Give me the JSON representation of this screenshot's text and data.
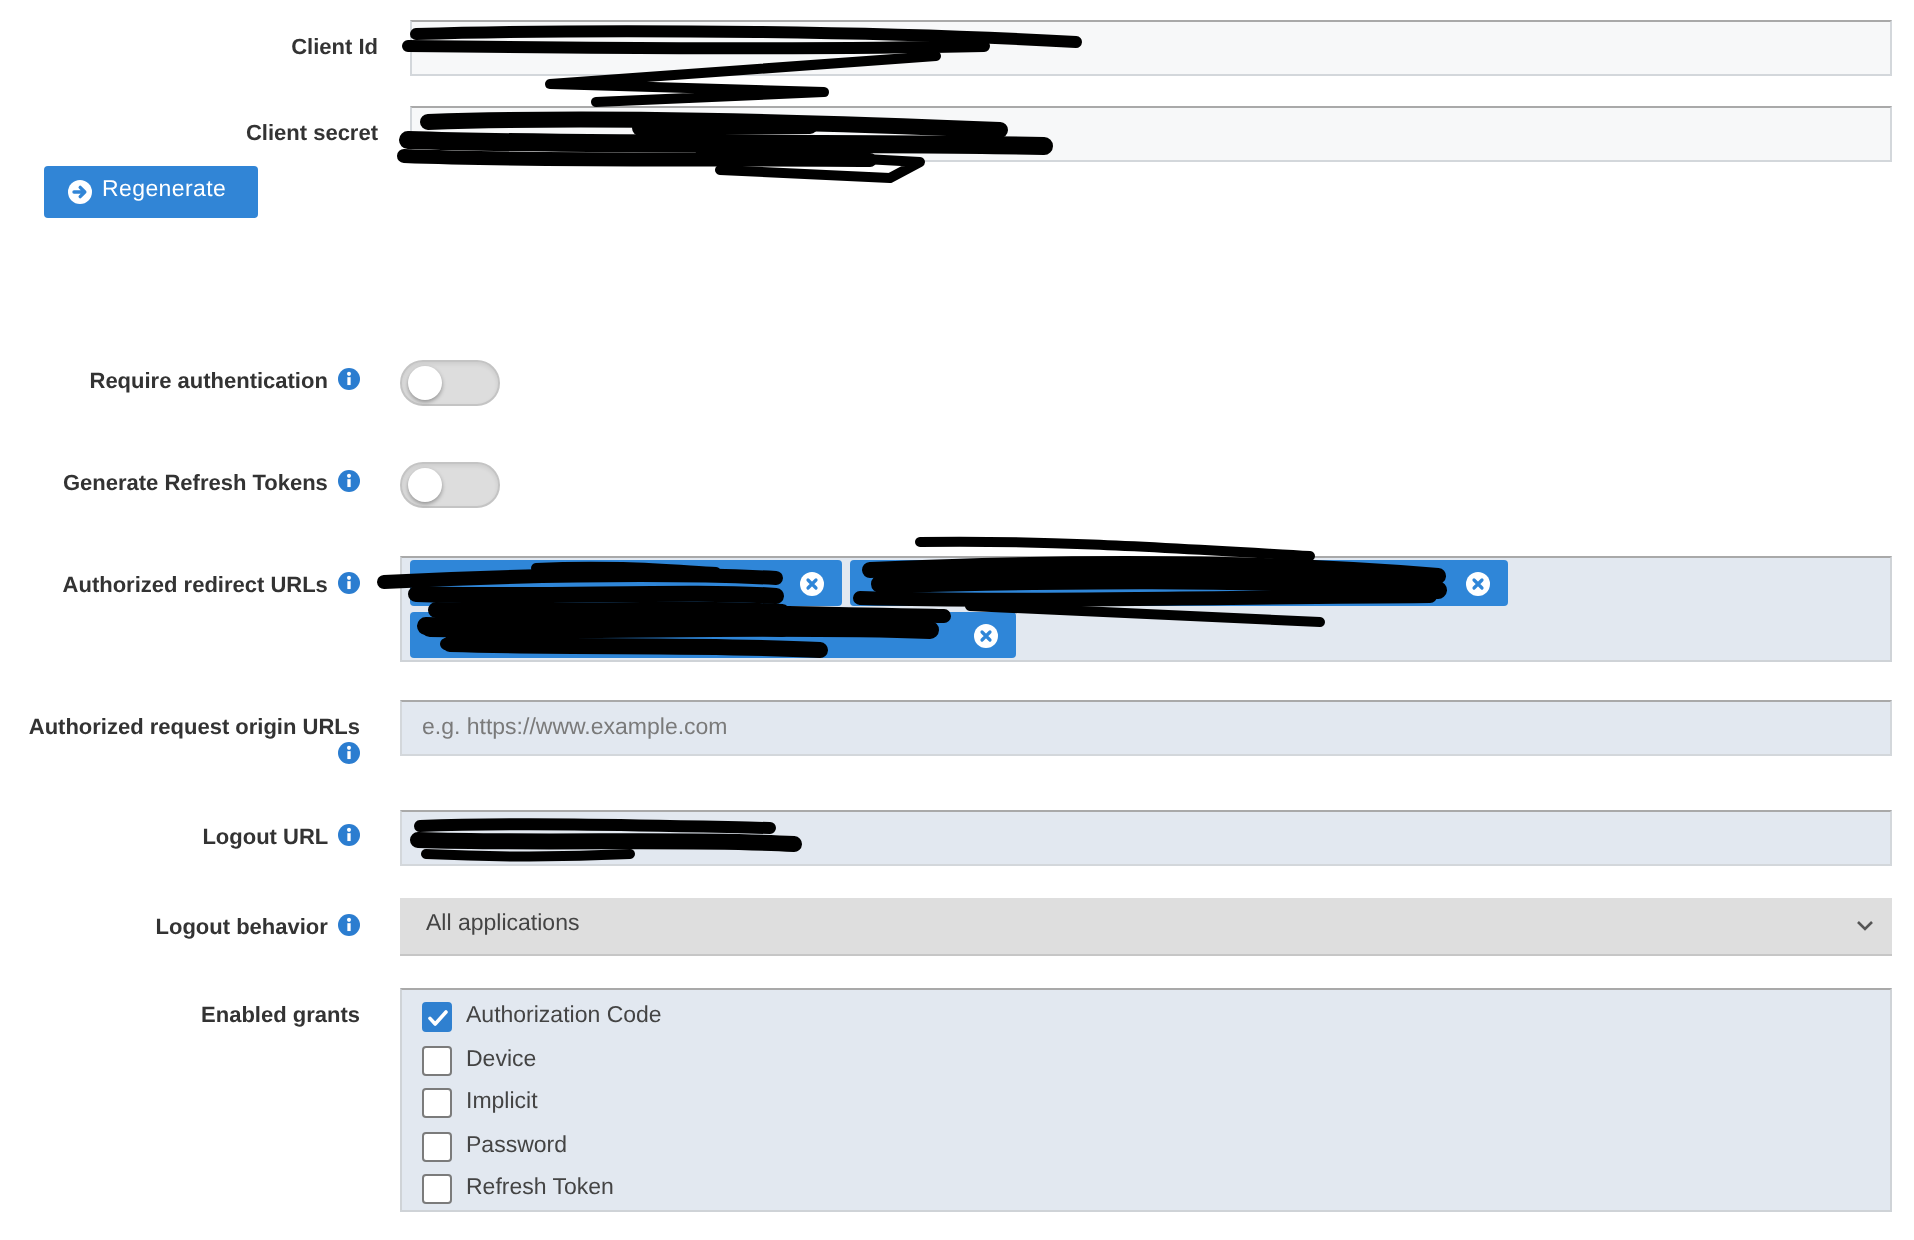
{
  "fields": [
    {
      "kind": "text",
      "label": "Client Id",
      "info": false,
      "redacted": true
    },
    {
      "kind": "text",
      "label": "Client secret",
      "info": false,
      "redacted": true
    },
    {
      "kind": "button",
      "label": "Regenerate"
    },
    {
      "kind": "toggle",
      "label": "Require authentication",
      "info": true,
      "on": false
    },
    {
      "kind": "toggle",
      "label": "Generate Refresh Tokens",
      "info": true,
      "on": false
    },
    {
      "kind": "tags",
      "label": "Authorized redirect URLs",
      "info": true,
      "tags": [
        {
          "redacted": true
        },
        {
          "redacted": true
        },
        {
          "redacted": true
        }
      ]
    },
    {
      "kind": "text",
      "label": "Authorized request origin URLs",
      "info": true,
      "placeholder": "e.g. https://www.example.com"
    },
    {
      "kind": "text",
      "label": "Logout URL",
      "info": true,
      "redacted": true
    },
    {
      "kind": "select",
      "label": "Logout behavior",
      "info": true,
      "value": "All applications"
    },
    {
      "kind": "checklist",
      "label": "Enabled grants",
      "info": false,
      "options": [
        {
          "label": "Authorization Code",
          "checked": true
        },
        {
          "label": "Device",
          "checked": false
        },
        {
          "label": "Implicit",
          "checked": false
        },
        {
          "label": "Password",
          "checked": false
        },
        {
          "label": "Refresh Token",
          "checked": false
        }
      ]
    }
  ]
}
